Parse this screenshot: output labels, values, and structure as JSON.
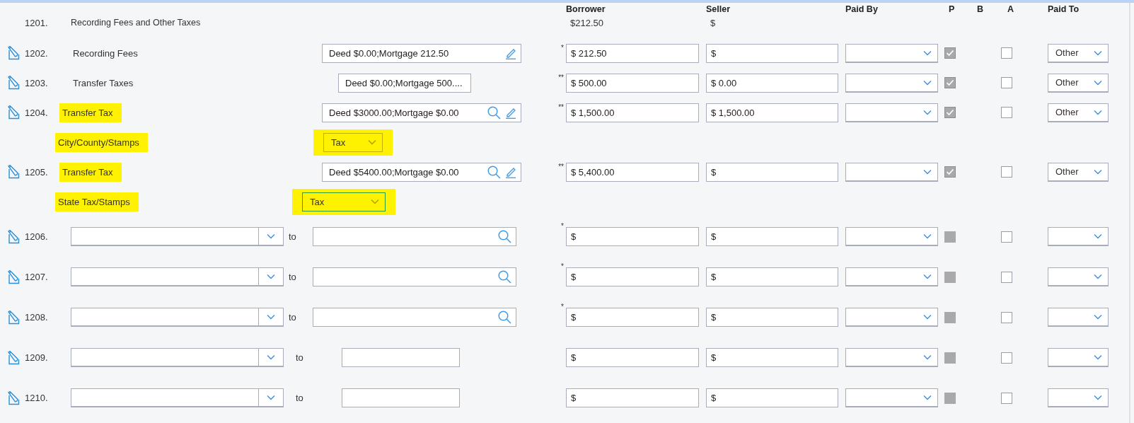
{
  "columns": [
    "Borrower",
    "Seller",
    "Paid By",
    "P",
    "B",
    "A",
    "Paid To"
  ],
  "section": {
    "number": "1201.",
    "title": "Recording Fees and Other Taxes",
    "borrower_total": "$212.50",
    "seller_total": "$"
  },
  "rows": [
    {
      "kind": "fee",
      "number": "1202.",
      "label": {
        "text": "Recording Fees",
        "highlighted": false
      },
      "description": {
        "value": "Deed $0.00;Mortgage 212.50",
        "kind": "editable",
        "search": false
      },
      "marker": "*",
      "borrower": "$ 212.50",
      "seller": "$",
      "p": {
        "checked": true,
        "disabled": true
      },
      "a_checked": false,
      "paid_to": "Other"
    },
    {
      "kind": "fee",
      "number": "1203.",
      "label": {
        "text": "Transfer Taxes",
        "highlighted": false
      },
      "description": {
        "value": "Deed $0.00;Mortgage 500....",
        "kind": "readonly",
        "search": false
      },
      "marker": "**",
      "borrower": "$ 500.00",
      "seller": "$ 0.00",
      "p": {
        "checked": true,
        "disabled": true
      },
      "a_checked": false,
      "paid_to": "Other"
    },
    {
      "kind": "fee",
      "number": "1204.",
      "label": {
        "text": "Transfer Tax",
        "highlighted": true
      },
      "description": {
        "value": "Deed $3000.00;Mortgage $0.00",
        "kind": "editable",
        "search": true
      },
      "marker": "**",
      "borrower": "$ 1,500.00",
      "seller": "$ 1,500.00",
      "p": {
        "checked": true,
        "disabled": true
      },
      "a_checked": false,
      "paid_to": "Other",
      "sub": {
        "label": {
          "text": "City/County/Stamps",
          "highlighted": true
        },
        "type": {
          "value": "Tax",
          "highlighted": true,
          "focused": false
        }
      }
    },
    {
      "kind": "fee",
      "number": "1205.",
      "label": {
        "text": "Transfer Tax",
        "highlighted": true
      },
      "description": {
        "value": "Deed $5400.00;Mortgage $0.00",
        "kind": "editable",
        "search": true
      },
      "marker": "**",
      "borrower": "$ 5,400.00",
      "seller": "$",
      "p": {
        "checked": true,
        "disabled": true
      },
      "a_checked": false,
      "paid_to": "Other",
      "sub": {
        "label": {
          "text": "State Tax/Stamps",
          "highlighted": true
        },
        "type": {
          "value": "Tax",
          "highlighted": true,
          "focused": true
        }
      }
    },
    {
      "kind": "blank",
      "number": "1206.",
      "to_label": "to",
      "to_search": true,
      "marker": "*",
      "borrower": "$",
      "seller": "$",
      "p": {
        "checked": false,
        "disabled": true
      },
      "a_checked": false
    },
    {
      "kind": "blank",
      "number": "1207.",
      "to_label": "to",
      "to_search": true,
      "marker": "*",
      "borrower": "$",
      "seller": "$",
      "p": {
        "checked": false,
        "disabled": true
      },
      "a_checked": false
    },
    {
      "kind": "blank",
      "number": "1208.",
      "to_label": "to",
      "to_search": true,
      "marker": "*",
      "borrower": "$",
      "seller": "$",
      "p": {
        "checked": false,
        "disabled": true
      },
      "a_checked": false
    },
    {
      "kind": "blank",
      "number": "1209.",
      "to_label": "to",
      "to_search": false,
      "borrower": "$",
      "seller": "$",
      "p": {
        "checked": false,
        "disabled": true
      },
      "a_checked": false
    },
    {
      "kind": "blank",
      "number": "1210.",
      "to_label": "to",
      "to_search": false,
      "borrower": "$",
      "seller": "$",
      "p": {
        "checked": false,
        "disabled": true
      },
      "a_checked": false
    }
  ]
}
